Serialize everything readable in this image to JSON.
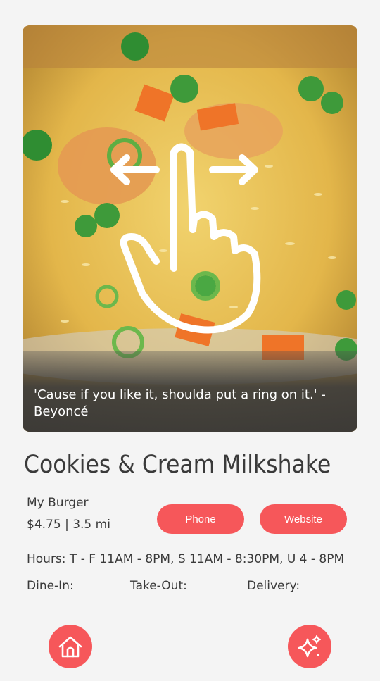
{
  "card": {
    "quote": "'Cause if you like it, shoulda put a ring on it.' - Beyoncé"
  },
  "item": {
    "name": "Cookies & Cream Milkshake",
    "restaurant": "My Burger",
    "price_distance": "$4.75 | 3.5 mi",
    "hours": "Hours: T - F 11AM - 8PM, S 11AM - 8:30PM, U 4 - 8PM"
  },
  "buttons": {
    "phone": "Phone",
    "website": "Website"
  },
  "services": {
    "dine_in": "Dine-In:",
    "take_out": "Take-Out:",
    "delivery": "Delivery:"
  },
  "nav": {
    "left_icon": "home-icon",
    "right_icon": "sparkle-icon"
  },
  "colors": {
    "accent": "#f6575a",
    "background": "#f4f4f4"
  }
}
